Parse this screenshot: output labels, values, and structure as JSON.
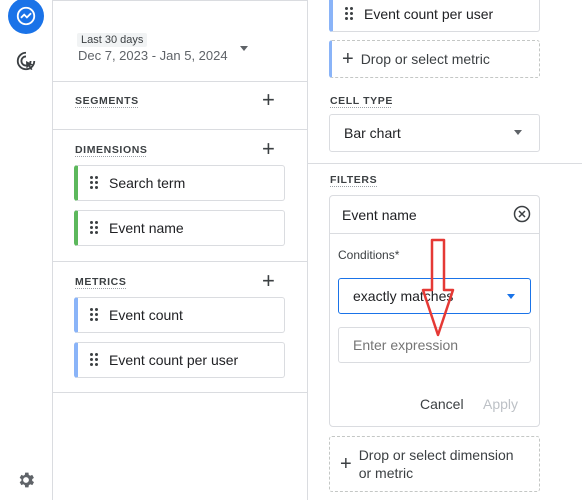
{
  "date": {
    "label": "Last 30 days",
    "range": "Dec 7, 2023 - Jan 5, 2024"
  },
  "segments": {
    "title": "SEGMENTS"
  },
  "dimensions": {
    "title": "DIMENSIONS",
    "items": [
      "Search term",
      "Event name"
    ]
  },
  "metrics": {
    "title": "METRICS",
    "items": [
      "Event count",
      "Event count per user"
    ]
  },
  "right": {
    "metric_top": "Event count per user",
    "metric_drop": "Drop or select metric",
    "cell_type_title": "CELL TYPE",
    "cell_type_value": "Bar chart",
    "filters_title": "FILTERS",
    "filter_dimension": "Event name",
    "conditions_label": "Conditions*",
    "condition_value": "exactly matches",
    "expression_placeholder": "Enter expression",
    "cancel": "Cancel",
    "apply": "Apply",
    "drop_dimension_line1": "Drop or select dimension",
    "drop_dimension_line2": "or metric"
  },
  "colors": {
    "accent": "#1a73e8",
    "arrow": "#e53935",
    "dimension_bar": "#5cb85c",
    "metric_bar": "#8ab4f8"
  }
}
